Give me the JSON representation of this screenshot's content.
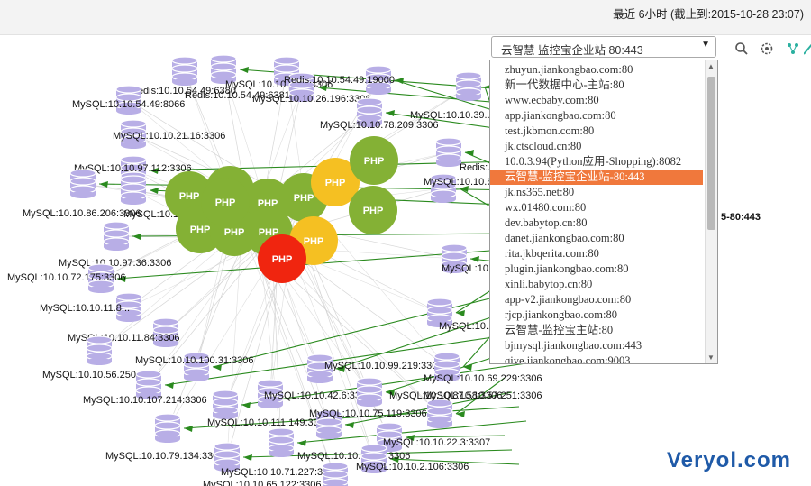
{
  "header": {
    "time_range": "最近 6小时 (截止到:2015-10-28 23:07)"
  },
  "site_select": {
    "value": "云智慧 监控宝企业站 80:443",
    "options": [
      "zhuyun.jiankongbao.com:80",
      "新一代数据中心-主站:80",
      "www.ecbaby.com:80",
      "app.jiankongbao.com:80",
      "test.jkbmon.com:80",
      "jk.ctscloud.cn:80",
      "10.0.3.94(Python应用-Shopping):8082",
      "云智慧-监控宝企业站-80:443",
      "jk.ns365.net:80",
      "wx.01480.com:80",
      "dev.babytop.cn:80",
      "danet.jiankongbao.com:80",
      "rita.jkbqerita.com:80",
      "plugin.jiankongbao.com:80",
      "xinli.babytop.cn:80",
      "app-v2.jiankongbao.com:80",
      "rjcp.jiankongbao.com:80",
      "云智慧-监控宝主站:80",
      "bjmysql.jiankongbao.com:443",
      "qiye.jiankongbao.com:9003"
    ],
    "selected_index": 7
  },
  "toolbar": {
    "search_icon": "search-icon",
    "settings_icon": "gear-icon",
    "share_icon": "share-icon",
    "expand_icon": "expand-icon"
  },
  "focus_label": "5-80:443",
  "php_label": "PHP",
  "php_nodes": [
    {
      "label": "PHP",
      "status": "ok",
      "color": "#84b135"
    },
    {
      "label": "PHP",
      "status": "ok",
      "color": "#84b135"
    },
    {
      "label": "PHP",
      "status": "ok",
      "color": "#84b135"
    },
    {
      "label": "PHP",
      "status": "ok",
      "color": "#84b135"
    },
    {
      "label": "PHP",
      "status": "ok",
      "color": "#84b135"
    },
    {
      "label": "PHP",
      "status": "ok",
      "color": "#84b135"
    },
    {
      "label": "PHP",
      "status": "ok",
      "color": "#84b135"
    },
    {
      "label": "PHP",
      "status": "ok",
      "color": "#84b135"
    },
    {
      "label": "PHP",
      "status": "warn",
      "color": "#f5c022"
    },
    {
      "label": "PHP",
      "status": "warn",
      "color": "#f5c022"
    },
    {
      "label": "PHP",
      "status": "error",
      "color": "#f0250f"
    },
    {
      "label": "PHP",
      "status": "ok",
      "color": "#84b135"
    },
    {
      "label": "PHP",
      "status": "ok",
      "color": "#84b135"
    }
  ],
  "db_nodes": [
    {
      "label": "Redis:10.10.54.49:6380"
    },
    {
      "label": "Redis:10.10.54.49:6381"
    },
    {
      "label": "MySQL:10.10.22.3:3306"
    },
    {
      "label": "MySQL:10.10.26.196:3306"
    },
    {
      "label": "Redis:10.10.54.49:19000"
    },
    {
      "label": "MySQL:10.10.54.49:8066"
    },
    {
      "label": "MySQL:10.10.21.16:3306"
    },
    {
      "label": "MySQL:10.10.78.209:3306"
    },
    {
      "label": "MySQL:10.10.39..."
    },
    {
      "label": "MySQL:10.10.97.112:3306"
    },
    {
      "label": "Redis:..."
    },
    {
      "label": "MySQL:10.10.86.206:3306"
    },
    {
      "label": "MySQL:10.10.6.222:3306"
    },
    {
      "label": "MySQL:10.10.65.40..."
    },
    {
      "label": "MySQL:10.10.97.36:3306"
    },
    {
      "label": "MySQL:10.10.72.175:3306"
    },
    {
      "label": "MySQL:10.10.11.8..."
    },
    {
      "label": "MySQL:10.10.100.42..."
    },
    {
      "label": "MySQL:10.10.11.84:3306"
    },
    {
      "label": "MySQL:10.10.111.176:..."
    },
    {
      "label": "MySQL:10.10.56.250:3306"
    },
    {
      "label": "MySQL:10.10.100.31:3306"
    },
    {
      "label": "MySQL:10.10.99.219:3306"
    },
    {
      "label": "MySQL:10.10.69.229:3306"
    },
    {
      "label": "MySQL:10.10.107.214:3306"
    },
    {
      "label": "MySQL:10.10.42.6:3306"
    },
    {
      "label": "MySQL:10.10.87.58:3306"
    },
    {
      "label": "MySQL:10.10.111.149:3306"
    },
    {
      "label": "MySQL:10.10.57.251:3306"
    },
    {
      "label": "MySQL:10.10.75.119:3306"
    },
    {
      "label": "MySQL:10.10.79.134:3306"
    },
    {
      "label": "MySQL:10.10.71.26:3306"
    },
    {
      "label": "MySQL:10.10.22.3:3307"
    },
    {
      "label": "MySQL:10.10.71.227:3306"
    },
    {
      "label": "MySQL:10.10.2.106:3306"
    },
    {
      "label": "MySQL:10.10.65.122:3306"
    }
  ],
  "colors": {
    "db": "#b8aee6",
    "edge_green": "#2a8a1e",
    "edge_gray": "#cfcfcf",
    "selected": "#f0783c"
  },
  "watermark": "Veryol.com"
}
